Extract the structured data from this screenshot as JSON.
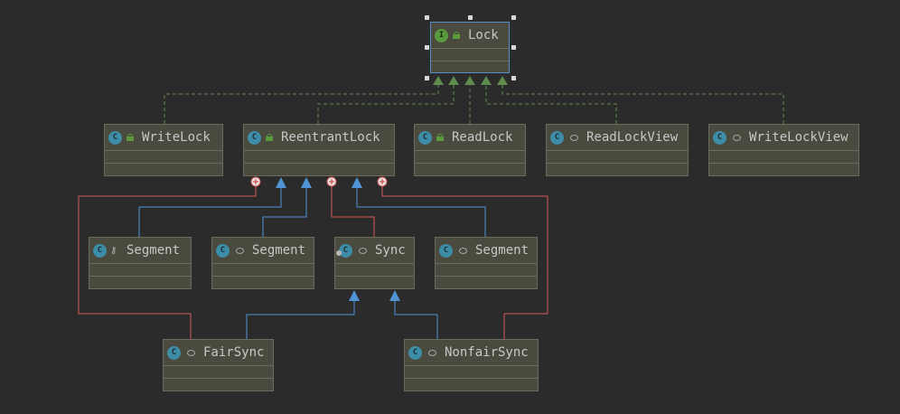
{
  "colors": {
    "background": "#2b2b2b",
    "node_fill": "#4b4a3e",
    "node_border": "#6b6b5e",
    "implements_edge": "#5f8b4c",
    "extends_edge": "#4f94d4",
    "inner_edge": "#d45858"
  },
  "icon_names": {
    "interface": "interface-icon",
    "class": "class-icon",
    "abstract_class": "abstract-class-icon",
    "public": "unlock-icon",
    "package_private": "circle-icon",
    "private": "key-icon"
  },
  "nodes": [
    {
      "id": "lock",
      "label": "Lock",
      "kind": "interface",
      "visibility": "public",
      "selected": true
    },
    {
      "id": "writelock",
      "label": "WriteLock",
      "kind": "class",
      "visibility": "public"
    },
    {
      "id": "reentrantlock",
      "label": "ReentrantLock",
      "kind": "class",
      "visibility": "public"
    },
    {
      "id": "readlock",
      "label": "ReadLock",
      "kind": "class",
      "visibility": "public"
    },
    {
      "id": "readlockview",
      "label": "ReadLockView",
      "kind": "class",
      "visibility": "package"
    },
    {
      "id": "writelockview",
      "label": "WriteLockView",
      "kind": "class",
      "visibility": "package"
    },
    {
      "id": "segment1",
      "label": "Segment",
      "kind": "class",
      "visibility": "private"
    },
    {
      "id": "segment2",
      "label": "Segment",
      "kind": "class",
      "visibility": "package"
    },
    {
      "id": "sync",
      "label": "Sync",
      "kind": "abstract",
      "visibility": "package"
    },
    {
      "id": "segment3",
      "label": "Segment",
      "kind": "class",
      "visibility": "package"
    },
    {
      "id": "fairsync",
      "label": "FairSync",
      "kind": "class",
      "visibility": "package"
    },
    {
      "id": "nonfairsync",
      "label": "NonfairSync",
      "kind": "class",
      "visibility": "package"
    }
  ],
  "edges": [
    {
      "from": "writelock",
      "to": "lock",
      "type": "implements"
    },
    {
      "from": "reentrantlock",
      "to": "lock",
      "type": "implements"
    },
    {
      "from": "readlock",
      "to": "lock",
      "type": "implements"
    },
    {
      "from": "readlockview",
      "to": "lock",
      "type": "implements"
    },
    {
      "from": "writelockview",
      "to": "lock",
      "type": "implements"
    },
    {
      "from": "segment1",
      "to": "reentrantlock",
      "type": "extends"
    },
    {
      "from": "segment2",
      "to": "reentrantlock",
      "type": "extends"
    },
    {
      "from": "segment3",
      "to": "reentrantlock",
      "type": "extends"
    },
    {
      "from": "sync",
      "to": "reentrantlock",
      "type": "inner"
    },
    {
      "from": "fairsync",
      "to": "reentrantlock",
      "type": "inner"
    },
    {
      "from": "nonfairsync",
      "to": "reentrantlock",
      "type": "inner"
    },
    {
      "from": "fairsync",
      "to": "sync",
      "type": "extends"
    },
    {
      "from": "nonfairsync",
      "to": "sync",
      "type": "extends"
    }
  ]
}
